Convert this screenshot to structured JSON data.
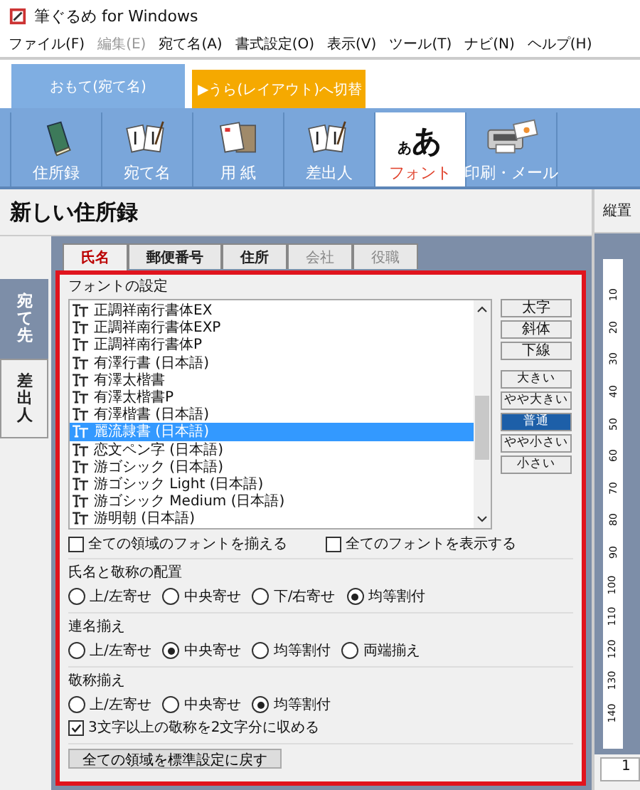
{
  "window": {
    "title": "筆ぐるめ for Windows"
  },
  "menu": [
    {
      "label": "ファイル(F)",
      "disabled": false
    },
    {
      "label": "編集(E)",
      "disabled": true
    },
    {
      "label": "宛て名(A)",
      "disabled": false
    },
    {
      "label": "書式設定(O)",
      "disabled": false
    },
    {
      "label": "表示(V)",
      "disabled": false
    },
    {
      "label": "ツール(T)",
      "disabled": false
    },
    {
      "label": "ナビ(N)",
      "disabled": false
    },
    {
      "label": "ヘルプ(H)",
      "disabled": false
    }
  ],
  "mode_tabs": [
    {
      "label": "おもて(宛て名)",
      "selected": true
    },
    {
      "label": "▶うら(レイアウト)へ切替",
      "selected": false
    }
  ],
  "toolbar": [
    {
      "label": "住所録",
      "kind": "book",
      "selected": false
    },
    {
      "label": "宛て名",
      "kind": "cards",
      "selected": false
    },
    {
      "label": "用 紙",
      "kind": "paper",
      "selected": false
    },
    {
      "label": "差出人",
      "kind": "cards",
      "selected": false
    },
    {
      "label": "フォント",
      "kind": "font",
      "glyphs": [
        "あ",
        "あ"
      ],
      "selected": true
    },
    {
      "label": "印刷・メール",
      "kind": "printer",
      "selected": false
    }
  ],
  "heading": "新しい住所録",
  "side_tabs": [
    {
      "label": "宛て先",
      "selected": true
    },
    {
      "label": "差出人",
      "selected": false
    }
  ],
  "field_tabs": [
    {
      "label": "氏名",
      "selected": true,
      "disabled": false
    },
    {
      "label": "郵便番号",
      "selected": false,
      "disabled": false
    },
    {
      "label": "住所",
      "selected": false,
      "disabled": false
    },
    {
      "label": "会社",
      "selected": false,
      "disabled": true
    },
    {
      "label": "役職",
      "selected": false,
      "disabled": true
    }
  ],
  "font_settings": {
    "title": "フォントの設定",
    "fonts": [
      {
        "name": "正調祥南行書体EX",
        "selected": false
      },
      {
        "name": "正調祥南行書体EXP",
        "selected": false
      },
      {
        "name": "正調祥南行書体P",
        "selected": false
      },
      {
        "name": "有澤行書 (日本語)",
        "selected": false
      },
      {
        "name": "有澤太楷書",
        "selected": false
      },
      {
        "name": "有澤太楷書P",
        "selected": false
      },
      {
        "name": "有澤楷書 (日本語)",
        "selected": false
      },
      {
        "name": "麗流隷書 (日本語)",
        "selected": true
      },
      {
        "name": "恋文ペン字 (日本語)",
        "selected": false
      },
      {
        "name": "游ゴシック (日本語)",
        "selected": false
      },
      {
        "name": "游ゴシック Light (日本語)",
        "selected": false
      },
      {
        "name": "游ゴシック Medium (日本語)",
        "selected": false
      },
      {
        "name": "游明朝 (日本語)",
        "selected": false
      }
    ],
    "style_buttons": [
      "太字",
      "斜体",
      "下線"
    ],
    "size_buttons": [
      {
        "label": "大きい",
        "selected": false
      },
      {
        "label": "やや大きい",
        "selected": false
      },
      {
        "label": "普通",
        "selected": true
      },
      {
        "label": "やや小さい",
        "selected": false
      },
      {
        "label": "小さい",
        "selected": false
      }
    ],
    "checkboxes": [
      {
        "label": "全ての領域のフォントを揃える",
        "checked": false
      },
      {
        "label": "全てのフォントを表示する",
        "checked": false
      }
    ]
  },
  "groups": [
    {
      "title": "氏名と敬称の配置",
      "options": [
        {
          "label": "上/左寄せ",
          "selected": false
        },
        {
          "label": "中央寄せ",
          "selected": false
        },
        {
          "label": "下/右寄せ",
          "selected": false
        },
        {
          "label": "均等割付",
          "selected": true
        }
      ]
    },
    {
      "title": "連名揃え",
      "options": [
        {
          "label": "上/左寄せ",
          "selected": false
        },
        {
          "label": "中央寄せ",
          "selected": true
        },
        {
          "label": "均等割付",
          "selected": false
        },
        {
          "label": "両端揃え",
          "selected": false
        }
      ]
    },
    {
      "title": "敬称揃え",
      "options": [
        {
          "label": "上/左寄せ",
          "selected": false
        },
        {
          "label": "中央寄せ",
          "selected": false
        },
        {
          "label": "均等割付",
          "selected": true
        }
      ],
      "checkboxes": [
        {
          "label": "3文字以上の敬称を2文字分に収める",
          "checked": true
        }
      ]
    }
  ],
  "reset_button": "全ての領域を標準設定に戻す",
  "right_panel": {
    "title": "縦置",
    "ruler": [
      "10",
      "20",
      "30",
      "40",
      "50",
      "60",
      "70",
      "80",
      "90",
      "100",
      "110",
      "120",
      "130",
      "140"
    ],
    "field_value": "1"
  }
}
